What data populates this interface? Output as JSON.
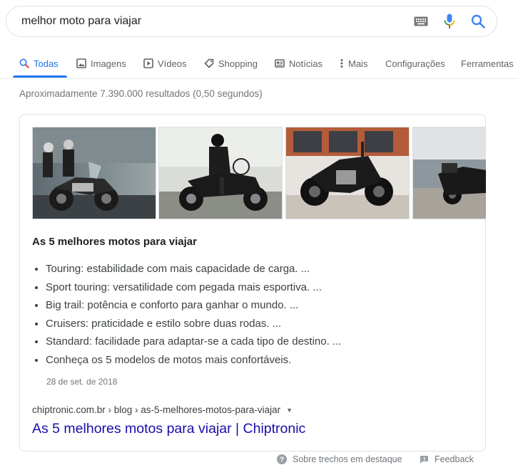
{
  "search": {
    "query": "melhor moto para viajar",
    "icons": [
      "keyboard-icon",
      "microphone-icon",
      "search-icon"
    ]
  },
  "tabs": [
    {
      "label": "Todas",
      "icon": "search-icon",
      "active": true
    },
    {
      "label": "Imagens",
      "icon": "image-icon"
    },
    {
      "label": "Vídeos",
      "icon": "video-icon"
    },
    {
      "label": "Shopping",
      "icon": "tag-icon"
    },
    {
      "label": "Notícias",
      "icon": "news-icon"
    },
    {
      "label": "Mais",
      "icon": "more-vert-icon"
    },
    {
      "label": "Configurações"
    },
    {
      "label": "Ferramentas"
    }
  ],
  "stats": "Aproximadamente 7.390.000 resultados (0,50 segundos)",
  "featured": {
    "title": "As 5 melhores motos para viajar",
    "bullets": [
      "Touring: estabilidade com mais capacidade de carga. ...",
      "Sport touring: versatilidade com pegada mais esportiva. ...",
      "Big trail: potência e conforto para ganhar o mundo. ...",
      "Cruisers: praticidade e estilo sobre duas rodas. ...",
      "Standard: facilidade para adaptar-se a cada tipo de destino. ...",
      "Conheça os 5 modelos de motos mais confortáveis."
    ],
    "date": "28 de set. de 2018",
    "breadcrumb": "chiptronic.com.br › blog › as-5-melhores-motos-para-viajar",
    "link_title": "As 5 melhores motos para viajar | Chiptronic"
  },
  "footer": {
    "about": "Sobre trechos em destaque",
    "feedback": "Feedback"
  },
  "colors": {
    "accent": "#1a73e8",
    "link": "#1a0dab",
    "muted": "#70757a"
  }
}
